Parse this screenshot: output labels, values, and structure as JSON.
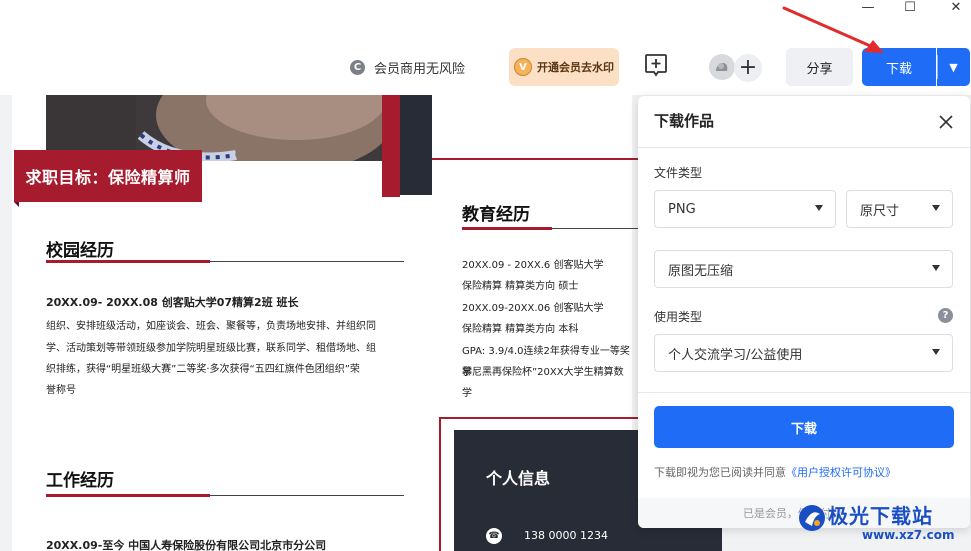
{
  "window": {
    "minimize": "—",
    "maximize": "☐",
    "close": "✕"
  },
  "toolbar": {
    "commercial_label": "会员商用无风险",
    "vip_badge": "V",
    "vip_label": "开通会员去水印",
    "share_label": "分享",
    "download_label": "下载"
  },
  "resume": {
    "goal": "求职目标：保险精算师",
    "campus_title": "校园经历",
    "campus_header": "20XX.09- 20XX.08   创客贴大学07精算2班     班长",
    "campus_lines": [
      "组织、安排班级活动，如座谈会、班会、聚餐等，负责场地安排、并组织同",
      "学、活动策划等带领班级参加学院明星班级比赛，联系同学、租借场地、组",
      "织排练，获得“明星班级大赛”二等奖·多次获得“五四红旗件色团组织”荣",
      "誉称号"
    ],
    "work_title": "工作经历",
    "work_header": "20XX.09-至今 中国人寿保险股份有限公司北京市分公司",
    "edu_title": "教育经历",
    "edu_lines": [
      "20XX.09 - 20XX.6    创客贴大学",
      "保险精算 精算类方向 硕士",
      "20XX.09-20XX.06    创客贴大学",
      "保险精算  精算类方向 本科",
      "GPA: 3.9/4.0连续2年获得专业一等奖学",
      "慕尼黑再保险杯”20XX大学生精算数学"
    ],
    "info_title": "个人信息",
    "phone": "138 0000 1234"
  },
  "panel": {
    "title": "下载作品",
    "file_type_label": "文件类型",
    "file_format": "PNG",
    "file_size": "原尺寸",
    "compression": "原图无压缩",
    "usage_label": "使用类型",
    "usage_value": "个人交流学习/公益使用",
    "download_button": "下载",
    "agreement_prefix": "下载即视为您已阅读并同意",
    "agreement_link": "《用户授权许可协议》",
    "member_note": "已是会员，仍需付费"
  },
  "watermark": {
    "name": "极光下载站",
    "url": "www.xz7.com"
  },
  "colors": {
    "accent_blue": "#1f6cf7",
    "resume_red": "#a61c2e",
    "resume_dark": "#282c36"
  }
}
